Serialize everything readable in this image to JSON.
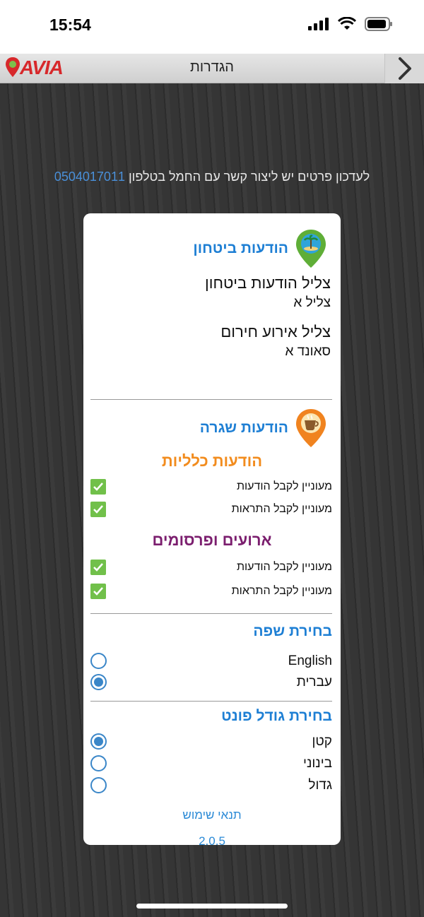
{
  "status_bar": {
    "time": "15:54"
  },
  "header": {
    "logo_text": "AVIA",
    "title": "הגדרות"
  },
  "contact": {
    "text": "לעדכון פרטים יש ליצור קשר עם החמל בטלפון",
    "phone": "0504017011"
  },
  "security": {
    "title": "הודעות ביטחון",
    "sound_label": "צליל הודעות ביטחון",
    "sound_value": "צליל א",
    "emergency_label": "צליל אירוע חירום",
    "emergency_value": "סאונד א"
  },
  "routine": {
    "title": "הודעות שגרה",
    "general_title": "הודעות כלליות",
    "general_items": [
      {
        "label": "מעוניין לקבל הודעות",
        "checked": true
      },
      {
        "label": "מעוניין לקבל התראות",
        "checked": true
      }
    ],
    "events_title": "ארועים ופרסומים",
    "events_items": [
      {
        "label": "מעוניין לקבל הודעות",
        "checked": true
      },
      {
        "label": "מעוניין לקבל התראות",
        "checked": true
      }
    ]
  },
  "language": {
    "title": "בחירת שפה",
    "options": [
      {
        "label": "English",
        "selected": false
      },
      {
        "label": "עברית",
        "selected": true
      }
    ]
  },
  "font_size": {
    "title": "בחירת גודל פונט",
    "options": [
      {
        "label": "קטן",
        "selected": true
      },
      {
        "label": "בינוני",
        "selected": false
      },
      {
        "label": "גדול",
        "selected": false
      }
    ]
  },
  "footer": {
    "terms": "תנאי שימוש",
    "version": "2.0.5"
  },
  "colors": {
    "accent_blue": "#1e7fd4",
    "orange": "#f28c1e",
    "purple": "#7b1e6e",
    "check_green": "#71c04a",
    "logo_red": "#d7282b"
  }
}
